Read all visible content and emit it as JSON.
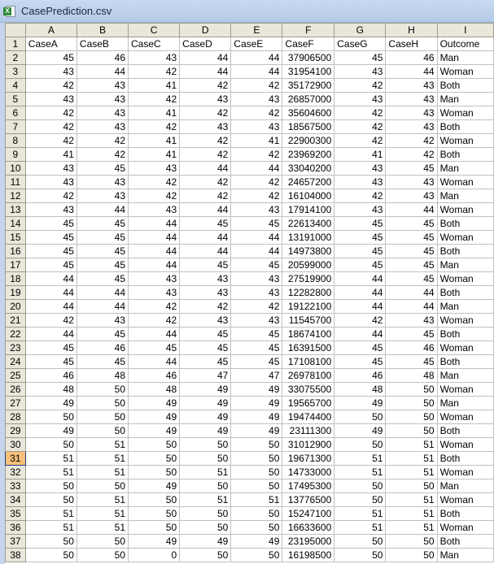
{
  "window": {
    "title": "CasePrediction.csv",
    "icon": "excel-icon"
  },
  "sheet": {
    "columns": [
      "A",
      "B",
      "C",
      "D",
      "E",
      "F",
      "G",
      "H",
      "I"
    ],
    "active_row": 31,
    "header_row": [
      "CaseA",
      "CaseB",
      "CaseC",
      "CaseD",
      "CaseE",
      "CaseF",
      "CaseG",
      "CaseH",
      "Outcome"
    ],
    "rows": [
      [
        45,
        46,
        43,
        44,
        44,
        "37906500",
        45,
        46,
        "Man"
      ],
      [
        43,
        44,
        42,
        44,
        44,
        "31954100",
        43,
        44,
        "Woman"
      ],
      [
        42,
        43,
        41,
        42,
        42,
        "35172900",
        42,
        43,
        "Both"
      ],
      [
        43,
        43,
        42,
        43,
        43,
        "26857000",
        43,
        43,
        "Man"
      ],
      [
        42,
        43,
        41,
        42,
        42,
        "35604600",
        42,
        43,
        "Woman"
      ],
      [
        42,
        43,
        42,
        43,
        43,
        "18567500",
        42,
        43,
        "Both"
      ],
      [
        42,
        42,
        41,
        42,
        41,
        "22900300",
        42,
        42,
        "Woman"
      ],
      [
        41,
        42,
        41,
        42,
        42,
        "23969200",
        41,
        42,
        "Both"
      ],
      [
        43,
        45,
        43,
        44,
        44,
        "33040200",
        43,
        45,
        "Man"
      ],
      [
        43,
        43,
        42,
        42,
        42,
        "24657200",
        43,
        43,
        "Woman"
      ],
      [
        42,
        43,
        42,
        42,
        42,
        "16104000",
        42,
        43,
        "Man"
      ],
      [
        43,
        44,
        43,
        44,
        43,
        "17914100",
        43,
        44,
        "Woman"
      ],
      [
        45,
        45,
        44,
        45,
        45,
        "22613400",
        45,
        45,
        "Both"
      ],
      [
        45,
        45,
        44,
        44,
        44,
        "13191000",
        45,
        45,
        "Woman"
      ],
      [
        45,
        45,
        44,
        44,
        44,
        "14973800",
        45,
        45,
        "Both"
      ],
      [
        45,
        45,
        44,
        45,
        45,
        "20599000",
        45,
        45,
        "Man"
      ],
      [
        44,
        45,
        43,
        43,
        43,
        "27519900",
        44,
        45,
        "Woman"
      ],
      [
        44,
        44,
        43,
        43,
        43,
        "12282800",
        44,
        44,
        "Both"
      ],
      [
        44,
        44,
        42,
        42,
        42,
        "19122100",
        44,
        44,
        "Man"
      ],
      [
        42,
        43,
        42,
        43,
        43,
        "11545700",
        42,
        43,
        "Woman"
      ],
      [
        44,
        45,
        44,
        45,
        45,
        "18674100",
        44,
        45,
        "Both"
      ],
      [
        45,
        46,
        45,
        45,
        45,
        "16391500",
        45,
        46,
        "Woman"
      ],
      [
        45,
        45,
        44,
        45,
        45,
        "17108100",
        45,
        45,
        "Both"
      ],
      [
        46,
        48,
        46,
        47,
        47,
        "26978100",
        46,
        48,
        "Man"
      ],
      [
        48,
        50,
        48,
        49,
        49,
        "33075500",
        48,
        50,
        "Woman"
      ],
      [
        49,
        50,
        49,
        49,
        49,
        "19565700",
        49,
        50,
        "Man"
      ],
      [
        50,
        50,
        49,
        49,
        49,
        "19474400",
        50,
        50,
        "Woman"
      ],
      [
        49,
        50,
        49,
        49,
        49,
        "23111300",
        49,
        50,
        "Both"
      ],
      [
        50,
        51,
        50,
        50,
        50,
        "31012900",
        50,
        51,
        "Woman"
      ],
      [
        51,
        51,
        50,
        50,
        50,
        "19671300",
        51,
        51,
        "Both"
      ],
      [
        51,
        51,
        50,
        51,
        50,
        "14733000",
        51,
        51,
        "Woman"
      ],
      [
        50,
        50,
        49,
        50,
        50,
        "17495300",
        50,
        50,
        "Man"
      ],
      [
        50,
        51,
        50,
        51,
        51,
        "13776500",
        50,
        51,
        "Woman"
      ],
      [
        51,
        51,
        50,
        50,
        50,
        "15247100",
        51,
        51,
        "Both"
      ],
      [
        51,
        51,
        50,
        50,
        50,
        "16633600",
        51,
        51,
        "Woman"
      ],
      [
        50,
        50,
        49,
        49,
        49,
        "23195000",
        50,
        50,
        "Both"
      ],
      [
        50,
        50,
        0,
        50,
        50,
        "16198500",
        50,
        50,
        "Man"
      ]
    ]
  }
}
